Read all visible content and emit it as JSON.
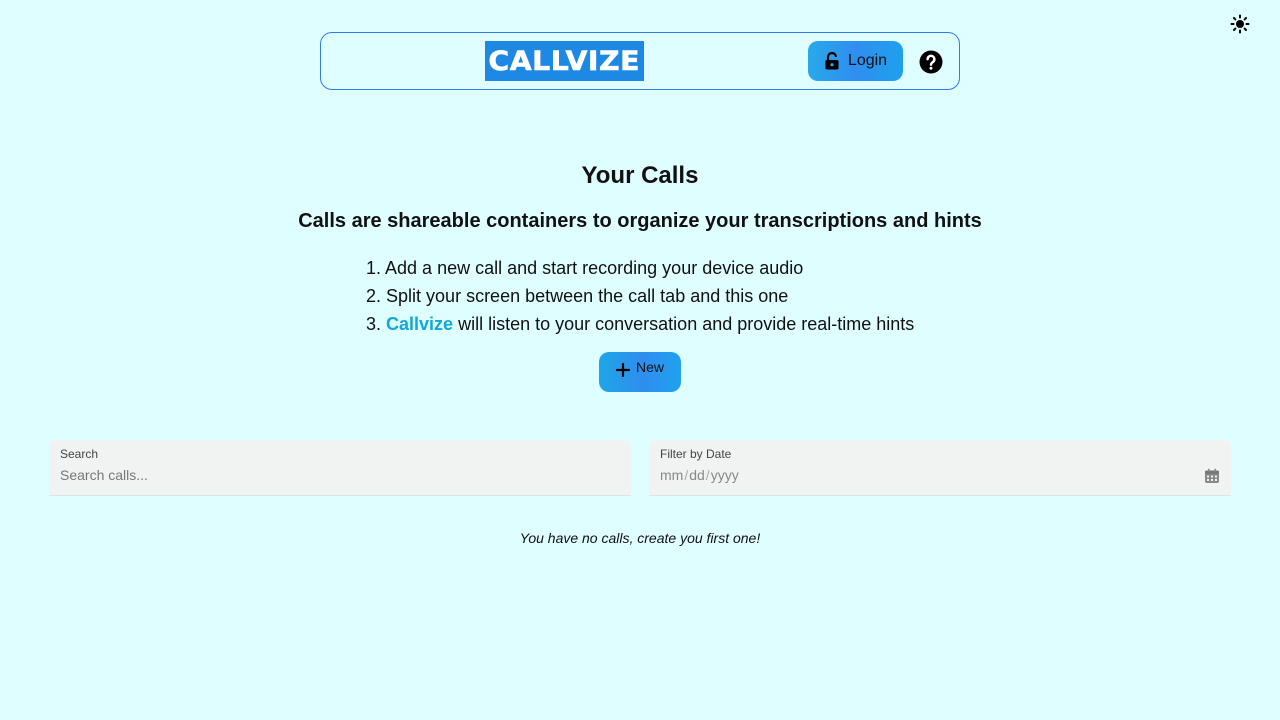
{
  "header": {
    "logo_text": "CALLVIZE",
    "login_label": "Login"
  },
  "main": {
    "title": "Your Calls",
    "subtitle": "Calls are shareable containers to organize your transcriptions and hints",
    "steps": [
      {
        "number": "1.",
        "text": "Add a new call and start recording your device audio"
      },
      {
        "number": "2.",
        "text": "Split your screen between the call tab and this one"
      },
      {
        "number": "3.",
        "brand": "Callvize",
        "text": "will listen to your conversation and provide real-time hints"
      }
    ],
    "new_button_label": "New"
  },
  "filters": {
    "search_label": "Search",
    "search_placeholder": "Search calls...",
    "date_label": "Filter by Date",
    "date_mm": "mm",
    "date_dd": "dd",
    "date_yyyy": "yyyy",
    "date_separator": "/"
  },
  "empty_message": "You have no calls, create you first one!",
  "icons": {
    "theme": "sun-icon",
    "login": "unlock-icon",
    "help": "question-circle-icon",
    "new": "plus-icon",
    "date": "calendar-icon"
  },
  "colors": {
    "background": "#dffeff",
    "accent": "#2f8ef0",
    "brand": "#12a7d8",
    "logo_bg": "#1e88e5",
    "header_border": "#2f7de0"
  }
}
